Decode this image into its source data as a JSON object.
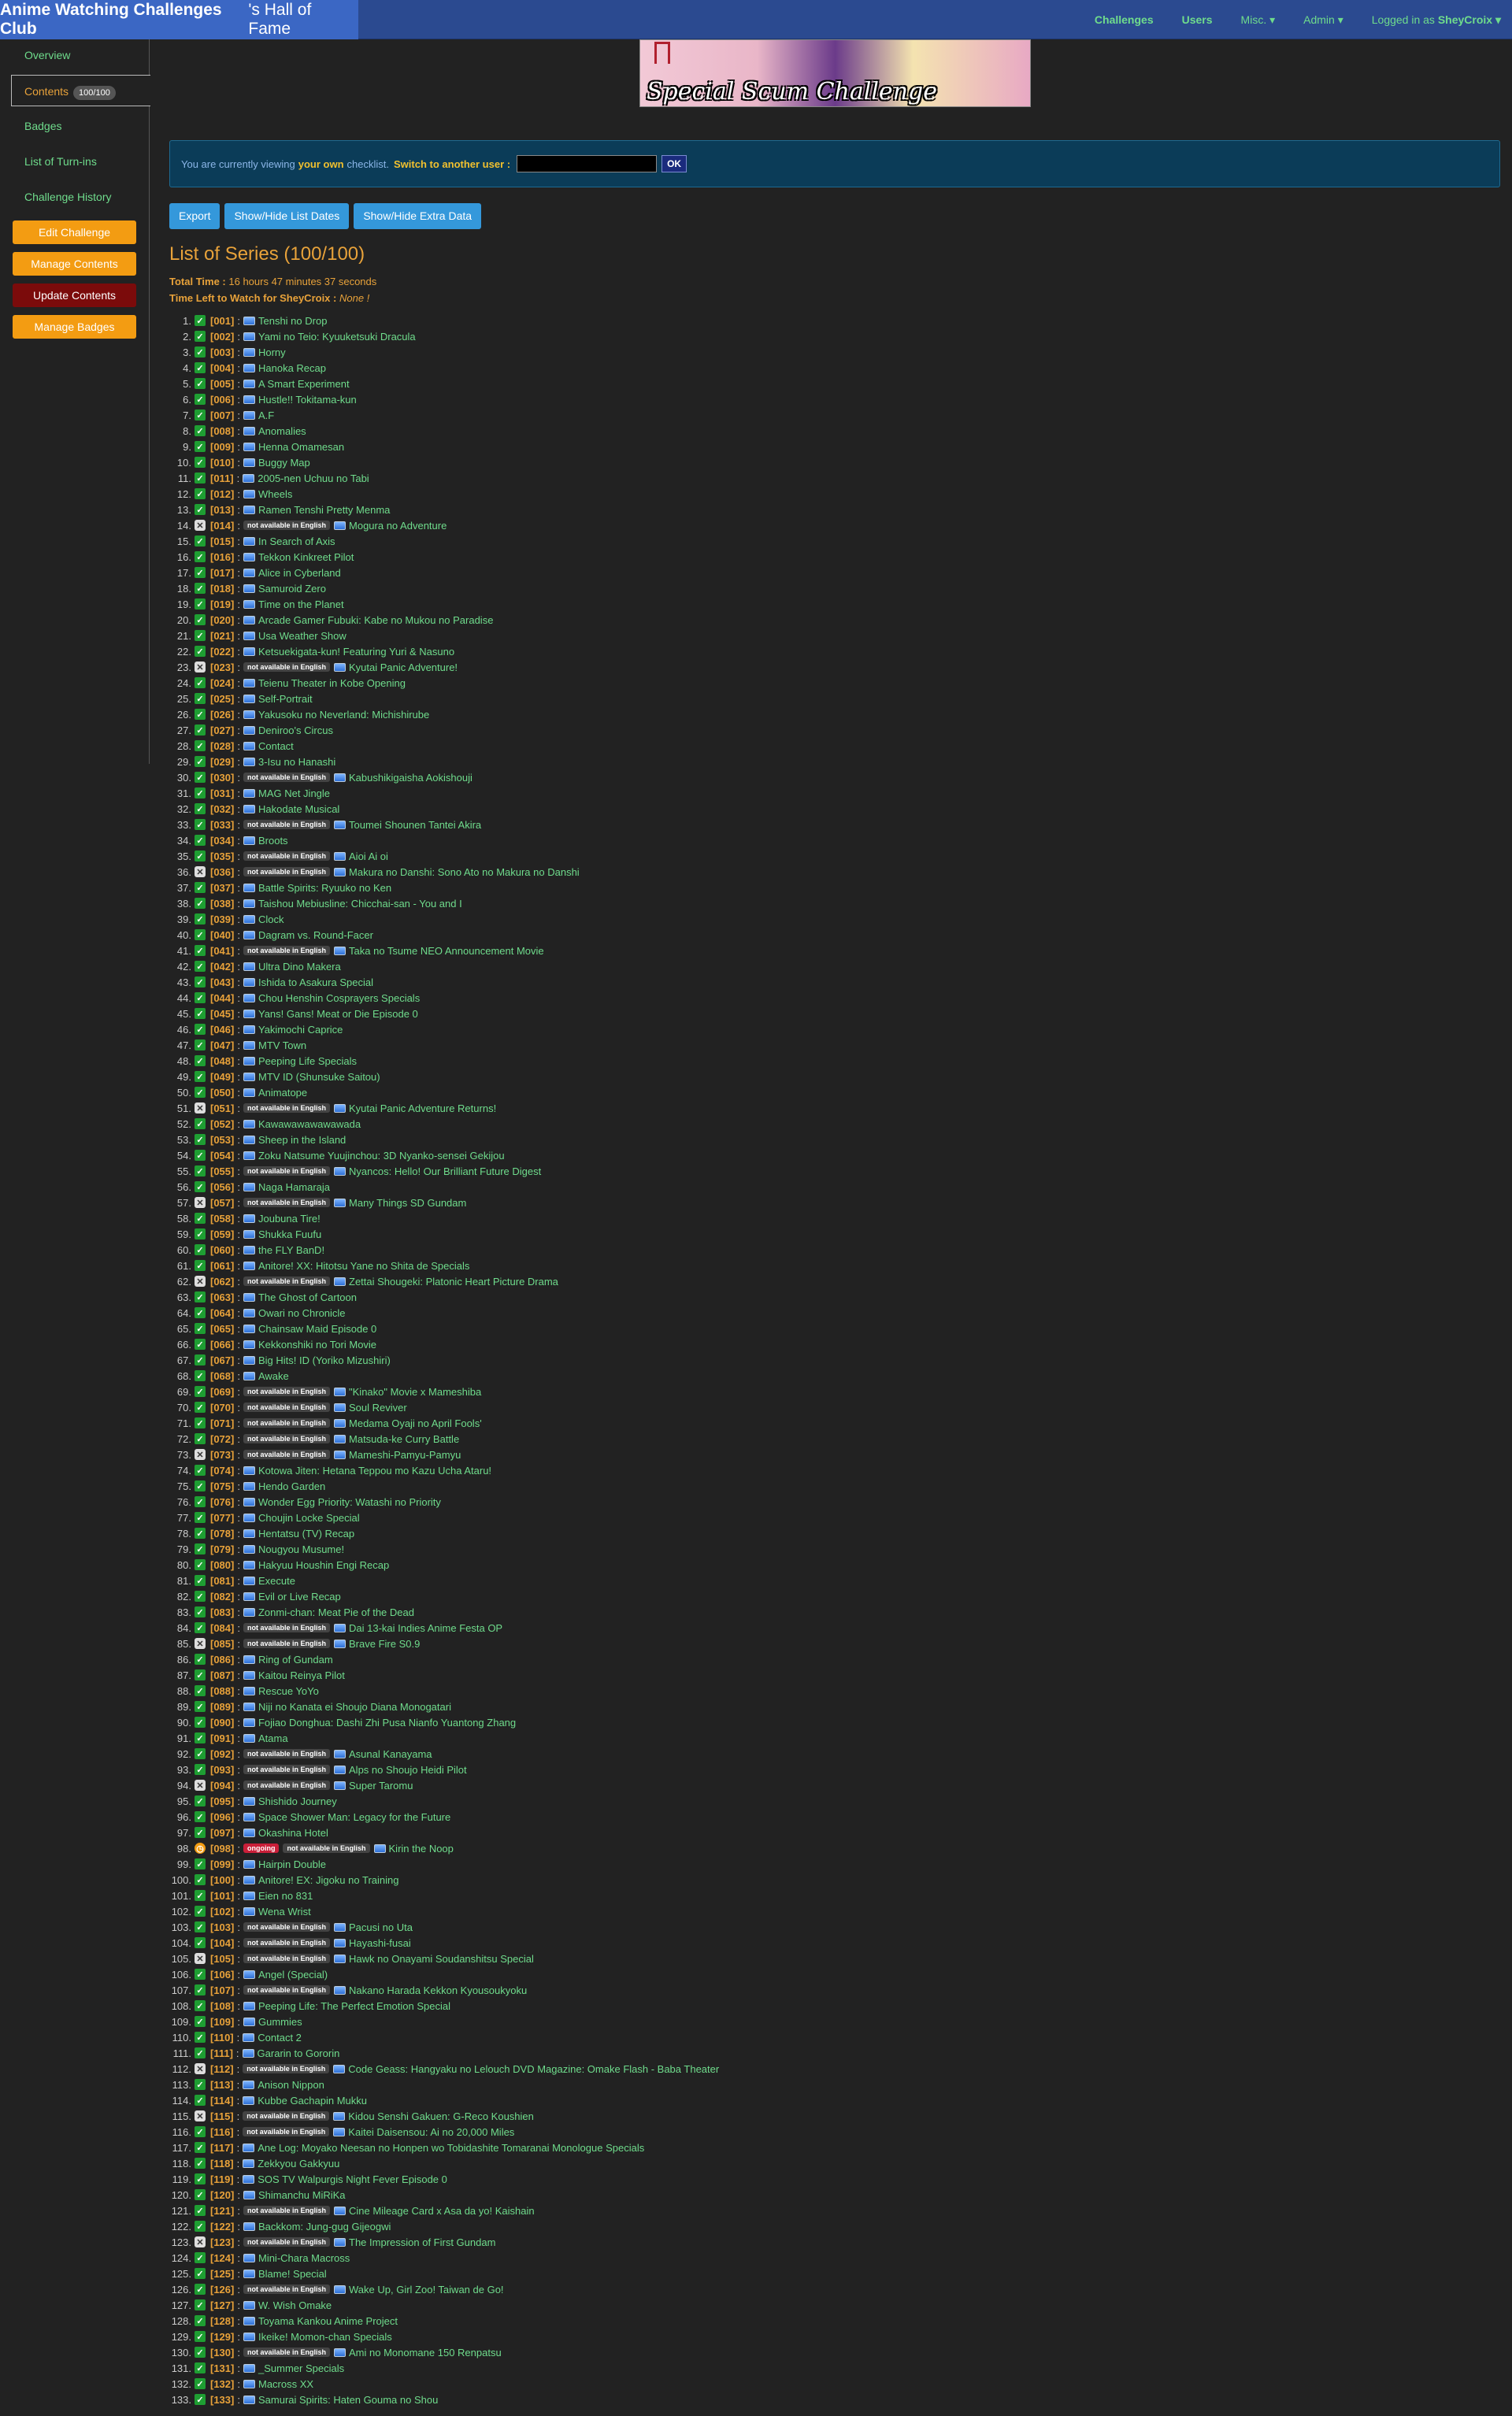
{
  "header": {
    "club": "Anime Watching Challenges Club",
    "club_suffix": "'s Hall of Fame",
    "nav": {
      "challenges": "Challenges",
      "users": "Users",
      "misc": "Misc. ▾",
      "admin": "Admin ▾",
      "logged_in": "Logged in as",
      "username": "SheyCroix ▾"
    }
  },
  "sidebar": {
    "overview": "Overview",
    "contents": "Contents",
    "contents_badge": "100/100",
    "badges": "Badges",
    "turnins": "List of Turn-ins",
    "history": "Challenge History",
    "edit": "Edit Challenge",
    "manage_contents": "Manage Contents",
    "update_contents": "Update Contents",
    "manage_badges": "Manage Badges"
  },
  "banner": {
    "title": "Special Scum Challenge"
  },
  "notice": {
    "pre": "You are currently viewing",
    "own": "your own",
    "post": "checklist.",
    "switch": "Switch to another user :",
    "ok": "OK"
  },
  "toolbar": {
    "export": "Export",
    "dates": "Show/Hide List Dates",
    "extra": "Show/Hide Extra Data"
  },
  "list": {
    "title": "List of Series (100/100)",
    "total_label": "Total Time :",
    "total_value": "16 hours 47 minutes 37 seconds",
    "left_label": "Time Left to Watch for SheyCroix :",
    "left_value": "None !"
  },
  "tags": {
    "nae": "not available in English",
    "ongoing": "ongoing"
  },
  "series": [
    [
      "1",
      "ok",
      "[001]",
      "",
      "Tenshi no Drop"
    ],
    [
      "2",
      "ok",
      "[002]",
      "",
      "Yami no Teio: Kyuuketsuki Dracula"
    ],
    [
      "3",
      "ok",
      "[003]",
      "",
      "Horny"
    ],
    [
      "4",
      "ok",
      "[004]",
      "",
      "Hanoka Recap"
    ],
    [
      "5",
      "ok",
      "[005]",
      "",
      "A Smart Experiment"
    ],
    [
      "6",
      "ok",
      "[006]",
      "",
      "Hustle!! Tokitama-kun"
    ],
    [
      "7",
      "ok",
      "[007]",
      "",
      "A.F"
    ],
    [
      "8",
      "ok",
      "[008]",
      "",
      "Anomalies"
    ],
    [
      "9",
      "ok",
      "[009]",
      "",
      "Henna Omamesan"
    ],
    [
      "10",
      "ok",
      "[010]",
      "",
      "Buggy Map"
    ],
    [
      "11",
      "ok",
      "[011]",
      "",
      "2005-nen Uchuu no Tabi"
    ],
    [
      "12",
      "ok",
      "[012]",
      "",
      "Wheels"
    ],
    [
      "13",
      "ok",
      "[013]",
      "",
      "Ramen Tenshi Pretty Menma"
    ],
    [
      "14",
      "x",
      "[014]",
      "n",
      "Mogura no Adventure"
    ],
    [
      "15",
      "ok",
      "[015]",
      "",
      "In Search of Axis"
    ],
    [
      "16",
      "ok",
      "[016]",
      "",
      "Tekkon Kinkreet Pilot"
    ],
    [
      "17",
      "ok",
      "[017]",
      "",
      "Alice in Cyberland"
    ],
    [
      "18",
      "ok",
      "[018]",
      "",
      "Samuroid Zero"
    ],
    [
      "19",
      "ok",
      "[019]",
      "",
      "Time on the Planet"
    ],
    [
      "20",
      "ok",
      "[020]",
      "",
      "Arcade Gamer Fubuki: Kabe no Mukou no Paradise"
    ],
    [
      "21",
      "ok",
      "[021]",
      "",
      "Usa Weather Show"
    ],
    [
      "22",
      "ok",
      "[022]",
      "",
      "Ketsuekigata-kun! Featuring Yuri & Nasuno"
    ],
    [
      "23",
      "x",
      "[023]",
      "n",
      "Kyutai Panic Adventure!"
    ],
    [
      "24",
      "ok",
      "[024]",
      "",
      "Teienu Theater in Kobe Opening"
    ],
    [
      "25",
      "ok",
      "[025]",
      "",
      "Self-Portrait"
    ],
    [
      "26",
      "ok",
      "[026]",
      "",
      "Yakusoku no Neverland: Michishirube"
    ],
    [
      "27",
      "ok",
      "[027]",
      "",
      "Deniroo's Circus"
    ],
    [
      "28",
      "ok",
      "[028]",
      "",
      "Contact"
    ],
    [
      "29",
      "ok",
      "[029]",
      "",
      "3-Isu no Hanashi"
    ],
    [
      "30",
      "ok",
      "[030]",
      "n",
      "Kabushikigaisha Aokishouji"
    ],
    [
      "31",
      "ok",
      "[031]",
      "",
      "MAG Net Jingle"
    ],
    [
      "32",
      "ok",
      "[032]",
      "",
      "Hakodate Musical"
    ],
    [
      "33",
      "ok",
      "[033]",
      "n",
      "Toumei Shounen Tantei Akira"
    ],
    [
      "34",
      "ok",
      "[034]",
      "",
      "Broots"
    ],
    [
      "35",
      "ok",
      "[035]",
      "n",
      "Aioi Ai oi"
    ],
    [
      "36",
      "x",
      "[036]",
      "n",
      "Makura no Danshi: Sono Ato no Makura no Danshi"
    ],
    [
      "37",
      "ok",
      "[037]",
      "",
      "Battle Spirits: Ryuuko no Ken"
    ],
    [
      "38",
      "ok",
      "[038]",
      "",
      "Taishou Mebiusline: Chicchai-san - You and I"
    ],
    [
      "39",
      "ok",
      "[039]",
      "",
      "Clock"
    ],
    [
      "40",
      "ok",
      "[040]",
      "",
      "Dagram vs. Round-Facer"
    ],
    [
      "41",
      "ok",
      "[041]",
      "n",
      "Taka no Tsume NEO Announcement Movie"
    ],
    [
      "42",
      "ok",
      "[042]",
      "",
      "Ultra Dino Makera"
    ],
    [
      "43",
      "ok",
      "[043]",
      "",
      "Ishida to Asakura Special"
    ],
    [
      "44",
      "ok",
      "[044]",
      "",
      "Chou Henshin Cosprayers Specials"
    ],
    [
      "45",
      "ok",
      "[045]",
      "",
      "Yans! Gans! Meat or Die Episode 0"
    ],
    [
      "46",
      "ok",
      "[046]",
      "",
      "Yakimochi Caprice"
    ],
    [
      "47",
      "ok",
      "[047]",
      "",
      "MTV Town"
    ],
    [
      "48",
      "ok",
      "[048]",
      "",
      "Peeping Life Specials"
    ],
    [
      "49",
      "ok",
      "[049]",
      "",
      "MTV ID (Shunsuke Saitou)"
    ],
    [
      "50",
      "ok",
      "[050]",
      "",
      "Animatope"
    ],
    [
      "51",
      "x",
      "[051]",
      "n",
      "Kyutai Panic Adventure Returns!"
    ],
    [
      "52",
      "ok",
      "[052]",
      "",
      "Kawawawawawawada"
    ],
    [
      "53",
      "ok",
      "[053]",
      "",
      "Sheep in the Island"
    ],
    [
      "54",
      "ok",
      "[054]",
      "",
      "Zoku Natsume Yuujinchou: 3D Nyanko-sensei Gekijou"
    ],
    [
      "55",
      "ok",
      "[055]",
      "n",
      "Nyancos: Hello! Our Brilliant Future Digest"
    ],
    [
      "56",
      "ok",
      "[056]",
      "",
      "Naga Hamaraja"
    ],
    [
      "57",
      "x",
      "[057]",
      "n",
      "Many Things SD Gundam"
    ],
    [
      "58",
      "ok",
      "[058]",
      "",
      "Joubuna Tire!"
    ],
    [
      "59",
      "ok",
      "[059]",
      "",
      "Shukka Fuufu"
    ],
    [
      "60",
      "ok",
      "[060]",
      "",
      "the FLY BanD!"
    ],
    [
      "61",
      "ok",
      "[061]",
      "",
      "Anitore! XX: Hitotsu Yane no Shita de Specials"
    ],
    [
      "62",
      "x",
      "[062]",
      "n",
      "Zettai Shougeki: Platonic Heart Picture Drama"
    ],
    [
      "63",
      "ok",
      "[063]",
      "",
      "The Ghost of Cartoon"
    ],
    [
      "64",
      "ok",
      "[064]",
      "",
      "Owari no Chronicle"
    ],
    [
      "65",
      "ok",
      "[065]",
      "",
      "Chainsaw Maid Episode 0"
    ],
    [
      "66",
      "ok",
      "[066]",
      "",
      "Kekkonshiki no Tori Movie"
    ],
    [
      "67",
      "ok",
      "[067]",
      "",
      "Big Hits! ID (Yoriko Mizushiri)"
    ],
    [
      "68",
      "ok",
      "[068]",
      "",
      "Awake"
    ],
    [
      "69",
      "ok",
      "[069]",
      "n",
      "\"Kinako\" Movie x Mameshiba"
    ],
    [
      "70",
      "ok",
      "[070]",
      "n",
      "Soul Reviver"
    ],
    [
      "71",
      "ok",
      "[071]",
      "n",
      "Medama Oyaji no April Fools'"
    ],
    [
      "72",
      "ok",
      "[072]",
      "n",
      "Matsuda-ke Curry Battle"
    ],
    [
      "73",
      "x",
      "[073]",
      "n",
      "Mameshi-Pamyu-Pamyu"
    ],
    [
      "74",
      "ok",
      "[074]",
      "",
      "Kotowa Jiten: Hetana Teppou mo Kazu Ucha Ataru!"
    ],
    [
      "75",
      "ok",
      "[075]",
      "",
      "Hendo Garden"
    ],
    [
      "76",
      "ok",
      "[076]",
      "",
      "Wonder Egg Priority: Watashi no Priority"
    ],
    [
      "77",
      "ok",
      "[077]",
      "",
      "Choujin Locke Special"
    ],
    [
      "78",
      "ok",
      "[078]",
      "",
      "Hentatsu (TV) Recap"
    ],
    [
      "79",
      "ok",
      "[079]",
      "",
      "Nougyou Musume!"
    ],
    [
      "80",
      "ok",
      "[080]",
      "",
      "Hakyuu Houshin Engi Recap"
    ],
    [
      "81",
      "ok",
      "[081]",
      "",
      "Execute"
    ],
    [
      "82",
      "ok",
      "[082]",
      "",
      "Evil or Live Recap"
    ],
    [
      "83",
      "ok",
      "[083]",
      "",
      "Zonmi-chan: Meat Pie of the Dead"
    ],
    [
      "84",
      "ok",
      "[084]",
      "n",
      "Dai 13-kai Indies Anime Festa OP"
    ],
    [
      "85",
      "x",
      "[085]",
      "n",
      "Brave Fire S0.9"
    ],
    [
      "86",
      "ok",
      "[086]",
      "",
      "Ring of Gundam"
    ],
    [
      "87",
      "ok",
      "[087]",
      "",
      "Kaitou Reinya Pilot"
    ],
    [
      "88",
      "ok",
      "[088]",
      "",
      "Rescue YoYo"
    ],
    [
      "89",
      "ok",
      "[089]",
      "",
      "Niji no Kanata ei Shoujo Diana Monogatari"
    ],
    [
      "90",
      "ok",
      "[090]",
      "",
      "Fojiao Donghua: Dashi Zhi Pusa Nianfo Yuantong Zhang"
    ],
    [
      "91",
      "ok",
      "[091]",
      "",
      "Atama"
    ],
    [
      "92",
      "ok",
      "[092]",
      "n",
      "Asunal Kanayama"
    ],
    [
      "93",
      "ok",
      "[093]",
      "n",
      "Alps no Shoujo Heidi Pilot"
    ],
    [
      "94",
      "x",
      "[094]",
      "n",
      "Super Taromu"
    ],
    [
      "95",
      "ok",
      "[095]",
      "",
      "Shishido Journey"
    ],
    [
      "96",
      "ok",
      "[096]",
      "",
      "Space Shower Man: Legacy for the Future"
    ],
    [
      "97",
      "ok",
      "[097]",
      "",
      "Okashina Hotel"
    ],
    [
      "98",
      "on",
      "[098]",
      "o",
      "Kirin the Noop"
    ],
    [
      "99",
      "ok",
      "[099]",
      "",
      "Hairpin Double"
    ],
    [
      "100",
      "ok",
      "[100]",
      "",
      "Anitore! EX: Jigoku no Training"
    ],
    [
      "101",
      "ok",
      "[101]",
      "",
      "Eien no 831"
    ],
    [
      "102",
      "ok",
      "[102]",
      "",
      "Wena Wrist"
    ],
    [
      "103",
      "ok",
      "[103]",
      "n",
      "Pacusi no Uta"
    ],
    [
      "104",
      "ok",
      "[104]",
      "n",
      "Hayashi-fusai"
    ],
    [
      "105",
      "x",
      "[105]",
      "n",
      "Hawk no Onayami Soudanshitsu Special"
    ],
    [
      "106",
      "ok",
      "[106]",
      "",
      "Angel (Special)"
    ],
    [
      "107",
      "ok",
      "[107]",
      "n",
      "Nakano Harada Kekkon Kyousoukyoku"
    ],
    [
      "108",
      "ok",
      "[108]",
      "",
      "Peeping Life: The Perfect Emotion Special"
    ],
    [
      "109",
      "ok",
      "[109]",
      "",
      "Gummies"
    ],
    [
      "110",
      "ok",
      "[110]",
      "",
      "Contact 2"
    ],
    [
      "111",
      "ok",
      "[111]",
      "",
      "Gararin to Gororin"
    ],
    [
      "112",
      "x",
      "[112]",
      "n",
      "Code Geass: Hangyaku no Lelouch DVD Magazine: Omake Flash - Baba Theater"
    ],
    [
      "113",
      "ok",
      "[113]",
      "",
      "Anison Nippon"
    ],
    [
      "114",
      "ok",
      "[114]",
      "",
      "Kubbe Gachapin Mukku"
    ],
    [
      "115",
      "x",
      "[115]",
      "n",
      "Kidou Senshi Gakuen: G-Reco Koushien"
    ],
    [
      "116",
      "ok",
      "[116]",
      "n",
      "Kaitei Daisensou: Ai no 20,000 Miles"
    ],
    [
      "117",
      "ok",
      "[117]",
      "",
      "Ane Log: Moyako Neesan no Honpen wo Tobidashite Tomaranai Monologue Specials"
    ],
    [
      "118",
      "ok",
      "[118]",
      "",
      "Zekkyou Gakkyuu"
    ],
    [
      "119",
      "ok",
      "[119]",
      "",
      "SOS TV Walpurgis Night Fever Episode 0"
    ],
    [
      "120",
      "ok",
      "[120]",
      "",
      "Shimanchu MiRiKa"
    ],
    [
      "121",
      "ok",
      "[121]",
      "n",
      "Cine Mileage Card x Asa da yo! Kaishain"
    ],
    [
      "122",
      "ok",
      "[122]",
      "",
      "Backkom: Jung-gug Gijeogwi"
    ],
    [
      "123",
      "x",
      "[123]",
      "n",
      "The Impression of First Gundam"
    ],
    [
      "124",
      "ok",
      "[124]",
      "",
      "Mini-Chara Macross"
    ],
    [
      "125",
      "ok",
      "[125]",
      "",
      "Blame! Special"
    ],
    [
      "126",
      "ok",
      "[126]",
      "n",
      "Wake Up, Girl Zoo! Taiwan de Go!"
    ],
    [
      "127",
      "ok",
      "[127]",
      "",
      "W. Wish Omake"
    ],
    [
      "128",
      "ok",
      "[128]",
      "",
      "Toyama Kankou Anime Project"
    ],
    [
      "129",
      "ok",
      "[129]",
      "",
      "Ikeike! Momon-chan Specials"
    ],
    [
      "130",
      "ok",
      "[130]",
      "n",
      "Ami no Monomane 150 Renpatsu"
    ],
    [
      "131",
      "ok",
      "[131]",
      "",
      "_Summer Specials"
    ],
    [
      "132",
      "ok",
      "[132]",
      "",
      "Macross XX"
    ],
    [
      "133",
      "ok",
      "[133]",
      "",
      "Samurai Spirits: Haten Gouma no Shou"
    ]
  ]
}
